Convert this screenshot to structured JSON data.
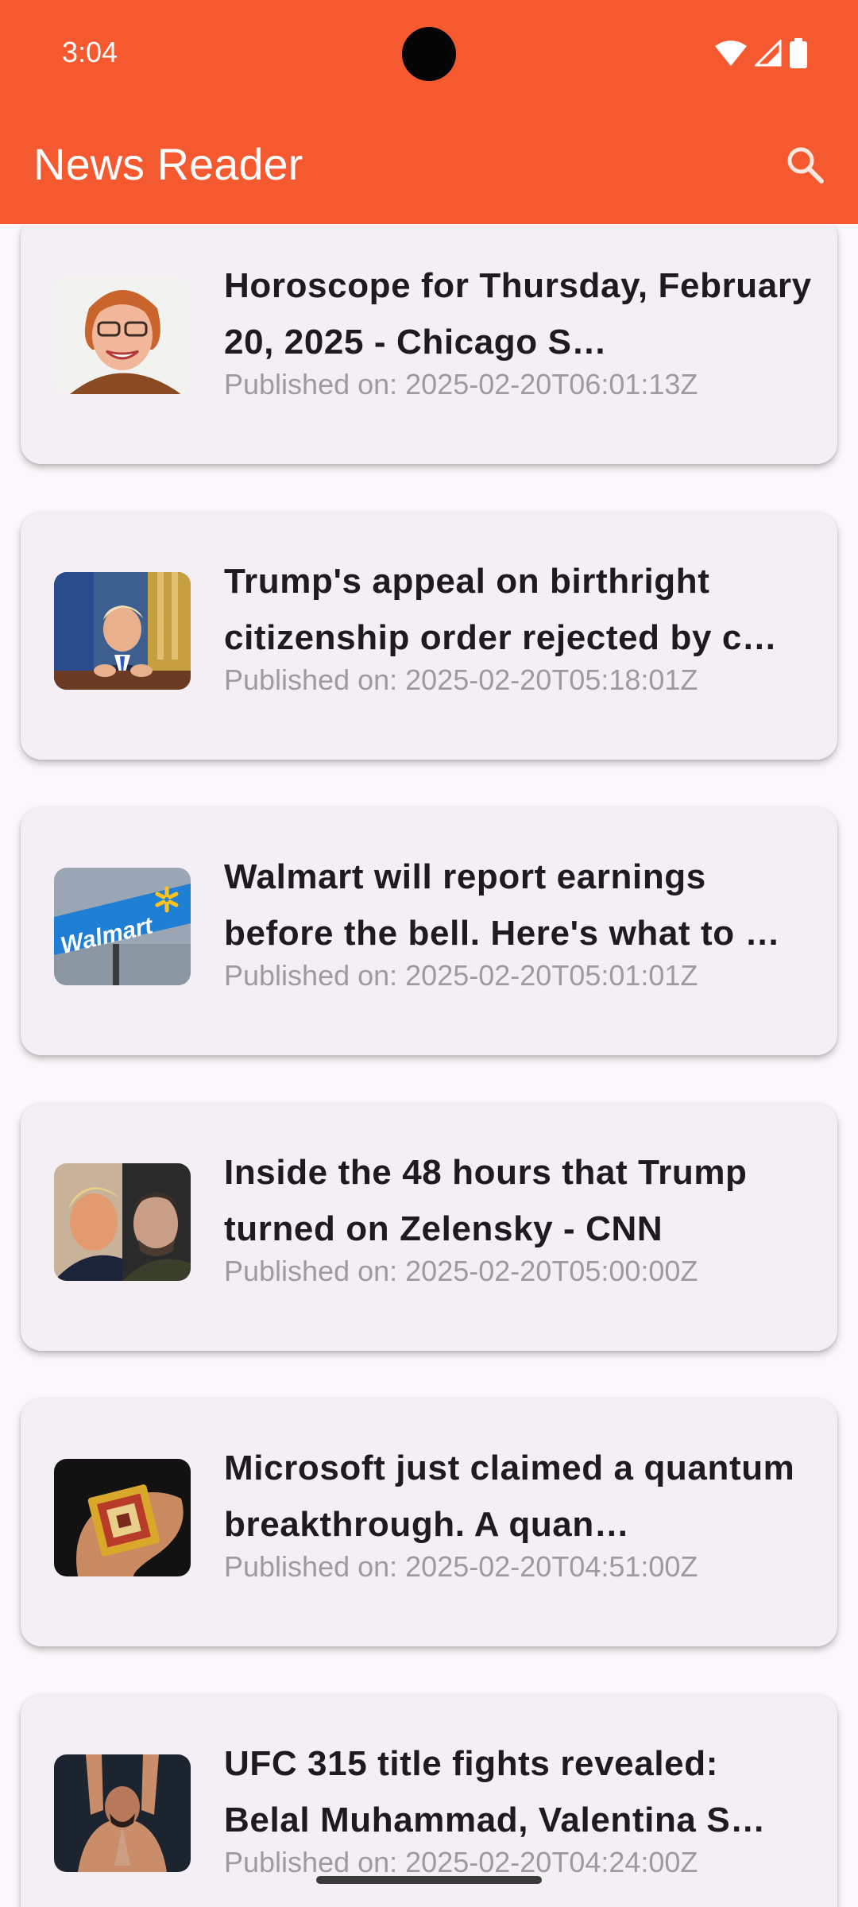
{
  "status_bar": {
    "time": "3:04",
    "icons": [
      "wifi-icon",
      "cell-signal-icon",
      "battery-icon"
    ]
  },
  "app_bar": {
    "title": "News Reader",
    "action_icon": "search-icon",
    "color": "#f4592f"
  },
  "articles": [
    {
      "title": "Horoscope for Thursday, February 20, 2025 - Chicago S…",
      "date": "Published on: 2025-02-20T06:01:13Z",
      "thumbnail": "woman-with-glasses"
    },
    {
      "title": "Trump's appeal on birthright citizenship order rejected by c…",
      "date": "Published on: 2025-02-20T05:18:01Z",
      "thumbnail": "man-at-desk"
    },
    {
      "title": "Walmart will report earnings before the bell. Here's what to …",
      "date": "Published on: 2025-02-20T05:01:01Z",
      "thumbnail": "walmart-sign",
      "thumbnail_text": "Walmart"
    },
    {
      "title": "Inside the 48 hours that Trump turned on Zelensky - CNN",
      "date": "Published on: 2025-02-20T05:00:00Z",
      "thumbnail": "two-men-portraits"
    },
    {
      "title": "Microsoft just claimed a quantum breakthrough. A quan…",
      "date": "Published on: 2025-02-20T04:51:00Z",
      "thumbnail": "chip-in-hand"
    },
    {
      "title": "UFC 315 title fights revealed: Belal Muhammad, Valentina S…",
      "date": "Published on: 2025-02-20T04:24:00Z",
      "thumbnail": "fighter-arms-raised"
    }
  ]
}
